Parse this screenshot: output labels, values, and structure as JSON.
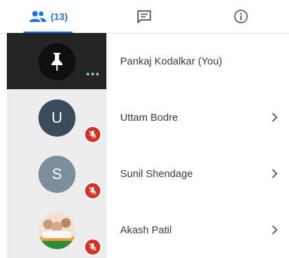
{
  "colors": {
    "accent": "#1a73e8",
    "self_tile_bg": "#242424",
    "tile_bg": "#ededed",
    "mute_badge": "#d93025",
    "avatar_U": "#3b4b5a",
    "avatar_S": "#7c8d9c",
    "more_dots": "#6fd3c8"
  },
  "tabs": {
    "people": {
      "icon": "people-icon",
      "count": "(13)"
    },
    "chat": {
      "icon": "chat-icon"
    },
    "info": {
      "icon": "info-icon"
    }
  },
  "participants": [
    {
      "name": "Pankaj Kodalkar (You)",
      "avatar_letter": "",
      "avatar_icon": "pin-icon",
      "muted": false
    },
    {
      "name": "Uttam Bodre",
      "avatar_letter": "U",
      "muted": true
    },
    {
      "name": "Sunil Shendage",
      "avatar_letter": "S",
      "muted": true
    },
    {
      "name": "Akash Patil",
      "avatar_letter": "",
      "avatar_icon": "photo-avatar",
      "muted": true
    }
  ]
}
